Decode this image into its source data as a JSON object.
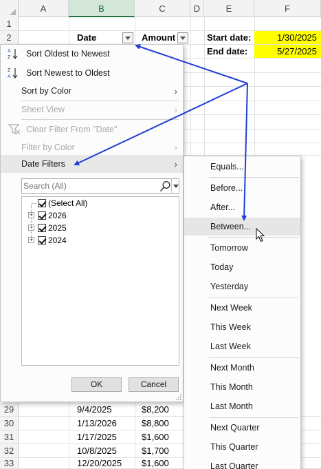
{
  "columns": [
    "A",
    "B",
    "C",
    "D",
    "E",
    "F"
  ],
  "row_numbers": [
    "1",
    "2",
    "29",
    "30",
    "31",
    "32",
    "33"
  ],
  "header": {
    "date_label": "Date",
    "amount_label": "Amount",
    "start_label": "Start date:",
    "end_label": "End date:",
    "start_value": "1/30/2025",
    "end_value": "5/27/2025"
  },
  "data_rows": [
    {
      "row": "29",
      "date": "9/4/2025",
      "amount": "$8,200"
    },
    {
      "row": "30",
      "date": "1/13/2026",
      "amount": "$8,800"
    },
    {
      "row": "31",
      "date": "1/17/2025",
      "amount": "$1,600"
    },
    {
      "row": "32",
      "date": "10/8/2025",
      "amount": "$1,700"
    },
    {
      "row": "33",
      "date": "12/20/2025",
      "amount": "$1,600"
    }
  ],
  "menu": {
    "sort_oldest": "Sort Oldest to Newest",
    "sort_newest": "Sort Newest to Oldest",
    "sort_by_color": "Sort by Color",
    "sheet_view": "Sheet View",
    "clear_filter": "Clear Filter From \"Date\"",
    "filter_by_color": "Filter by Color",
    "date_filters": "Date Filters"
  },
  "search": {
    "placeholder": "Search (All)"
  },
  "tree": {
    "select_all": "(Select All)",
    "years": [
      "2026",
      "2025",
      "2024"
    ]
  },
  "buttons": {
    "ok": "OK",
    "cancel": "Cancel"
  },
  "submenu": {
    "items": [
      "Equals...",
      "Before...",
      "After...",
      "Between...",
      "Tomorrow",
      "Today",
      "Yesterday",
      "Next Week",
      "This Week",
      "Last Week",
      "Next Month",
      "This Month",
      "Last Month",
      "Next Quarter",
      "This Quarter",
      "Last Quarter"
    ]
  },
  "colors": {
    "highlight_yellow": "#ffff00",
    "arrow_blue": "#1f3fd6",
    "selected_column_green": "#217346"
  }
}
